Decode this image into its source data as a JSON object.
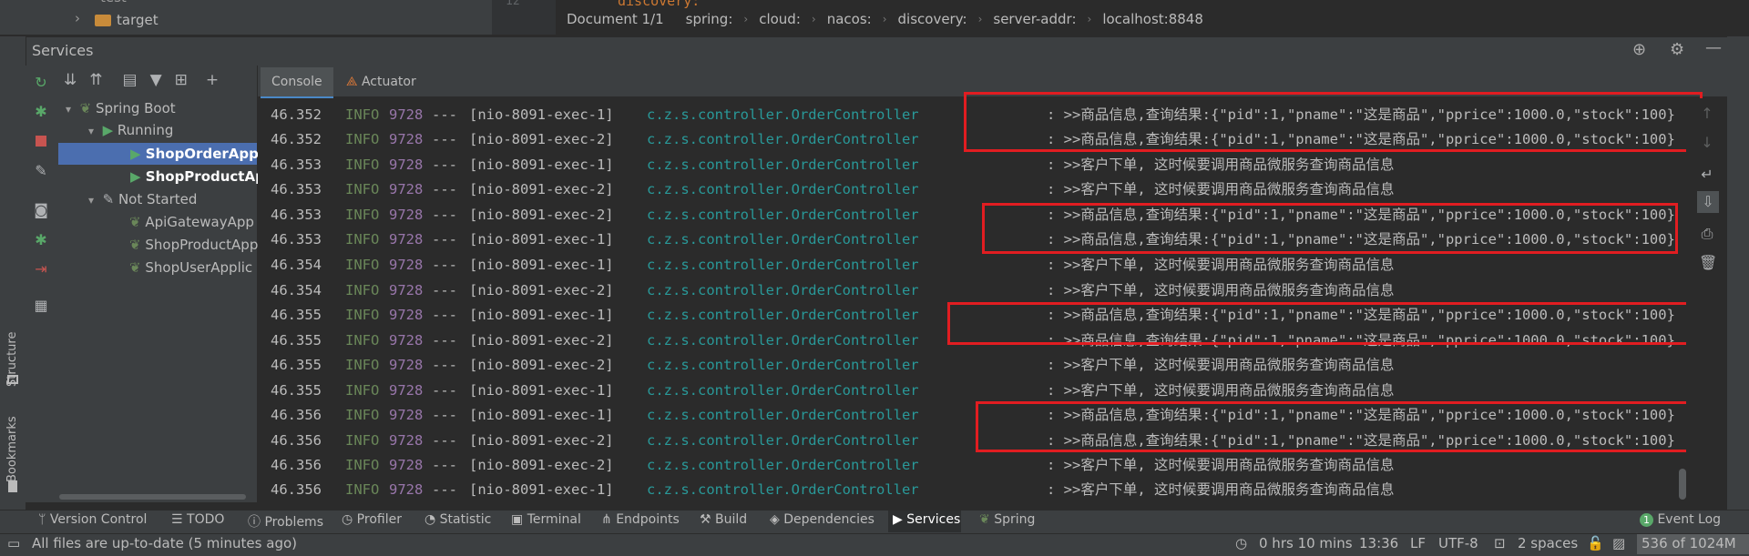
{
  "project": {
    "tree_item_partial": "test",
    "tree_item_target": "target"
  },
  "editor": {
    "code_fragment": "discovery:"
  },
  "breadcrumb": [
    "Document 1/1",
    "spring:",
    "cloud:",
    "nacos:",
    "discovery:",
    "server-addr:",
    "localhost:8848"
  ],
  "services": {
    "title": "Services",
    "tree": {
      "root": "Spring Boot",
      "running_group": "Running",
      "running": [
        "ShopOrderAppl",
        "ShopProductAp"
      ],
      "not_started_group": "Not Started",
      "not_started": [
        "ApiGatewayApp",
        "ShopProductApp",
        "ShopUserApplic"
      ]
    },
    "tabs": [
      "Console",
      "Actuator"
    ]
  },
  "log_lines": [
    {
      "time": "46.352",
      "level": "INFO",
      "pid": "9728",
      "dash": "---",
      "thread": "[nio-8091-exec-1]",
      "logger": "c.z.s.controller.OrderController",
      "message": ": >>商品信息,查询结果:{\"pid\":1,\"pname\":\"这是商品\",\"pprice\":1000.0,\"stock\":100}"
    },
    {
      "time": "46.352",
      "level": "INFO",
      "pid": "9728",
      "dash": "---",
      "thread": "[nio-8091-exec-2]",
      "logger": "c.z.s.controller.OrderController",
      "message": ": >>商品信息,查询结果:{\"pid\":1,\"pname\":\"这是商品\",\"pprice\":1000.0,\"stock\":100}"
    },
    {
      "time": "46.353",
      "level": "INFO",
      "pid": "9728",
      "dash": "---",
      "thread": "[nio-8091-exec-1]",
      "logger": "c.z.s.controller.OrderController",
      "message": ": >>客户下单, 这时候要调用商品微服务查询商品信息"
    },
    {
      "time": "46.353",
      "level": "INFO",
      "pid": "9728",
      "dash": "---",
      "thread": "[nio-8091-exec-2]",
      "logger": "c.z.s.controller.OrderController",
      "message": ": >>客户下单, 这时候要调用商品微服务查询商品信息"
    },
    {
      "time": "46.353",
      "level": "INFO",
      "pid": "9728",
      "dash": "---",
      "thread": "[nio-8091-exec-2]",
      "logger": "c.z.s.controller.OrderController",
      "message": ": >>商品信息,查询结果:{\"pid\":1,\"pname\":\"这是商品\",\"pprice\":1000.0,\"stock\":100}"
    },
    {
      "time": "46.353",
      "level": "INFO",
      "pid": "9728",
      "dash": "---",
      "thread": "[nio-8091-exec-1]",
      "logger": "c.z.s.controller.OrderController",
      "message": ": >>商品信息,查询结果:{\"pid\":1,\"pname\":\"这是商品\",\"pprice\":1000.0,\"stock\":100}"
    },
    {
      "time": "46.354",
      "level": "INFO",
      "pid": "9728",
      "dash": "---",
      "thread": "[nio-8091-exec-1]",
      "logger": "c.z.s.controller.OrderController",
      "message": ": >>客户下单, 这时候要调用商品微服务查询商品信息"
    },
    {
      "time": "46.354",
      "level": "INFO",
      "pid": "9728",
      "dash": "---",
      "thread": "[nio-8091-exec-2]",
      "logger": "c.z.s.controller.OrderController",
      "message": ": >>客户下单, 这时候要调用商品微服务查询商品信息"
    },
    {
      "time": "46.355",
      "level": "INFO",
      "pid": "9728",
      "dash": "---",
      "thread": "[nio-8091-exec-1]",
      "logger": "c.z.s.controller.OrderController",
      "message": ": >>商品信息,查询结果:{\"pid\":1,\"pname\":\"这是商品\",\"pprice\":1000.0,\"stock\":100}"
    },
    {
      "time": "46.355",
      "level": "INFO",
      "pid": "9728",
      "dash": "---",
      "thread": "[nio-8091-exec-2]",
      "logger": "c.z.s.controller.OrderController",
      "message": ": >>商品信息,查询结果:{\"pid\":1,\"pname\":\"这是商品\",\"pprice\":1000.0,\"stock\":100}"
    },
    {
      "time": "46.355",
      "level": "INFO",
      "pid": "9728",
      "dash": "---",
      "thread": "[nio-8091-exec-2]",
      "logger": "c.z.s.controller.OrderController",
      "message": ": >>客户下单, 这时候要调用商品微服务查询商品信息"
    },
    {
      "time": "46.355",
      "level": "INFO",
      "pid": "9728",
      "dash": "---",
      "thread": "[nio-8091-exec-1]",
      "logger": "c.z.s.controller.OrderController",
      "message": ": >>客户下单, 这时候要调用商品微服务查询商品信息"
    },
    {
      "time": "46.356",
      "level": "INFO",
      "pid": "9728",
      "dash": "---",
      "thread": "[nio-8091-exec-1]",
      "logger": "c.z.s.controller.OrderController",
      "message": ": >>商品信息,查询结果:{\"pid\":1,\"pname\":\"这是商品\",\"pprice\":1000.0,\"stock\":100}"
    },
    {
      "time": "46.356",
      "level": "INFO",
      "pid": "9728",
      "dash": "---",
      "thread": "[nio-8091-exec-2]",
      "logger": "c.z.s.controller.OrderController",
      "message": ": >>商品信息,查询结果:{\"pid\":1,\"pname\":\"这是商品\",\"pprice\":1000.0,\"stock\":100}"
    },
    {
      "time": "46.356",
      "level": "INFO",
      "pid": "9728",
      "dash": "---",
      "thread": "[nio-8091-exec-2]",
      "logger": "c.z.s.controller.OrderController",
      "message": ": >>客户下单, 这时候要调用商品微服务查询商品信息"
    },
    {
      "time": "46.356",
      "level": "INFO",
      "pid": "9728",
      "dash": "---",
      "thread": "[nio-8091-exec-1]",
      "logger": "c.z.s.controller.OrderController",
      "message": ": >>客户下单, 这时候要调用商品微服务查询商品信息"
    }
  ],
  "side_labels": {
    "structure": "Structure",
    "bookmarks": "Bookmarks"
  },
  "tool_windows": [
    "Version Control",
    "TODO",
    "Problems",
    "Profiler",
    "Statistic",
    "Terminal",
    "Endpoints",
    "Build",
    "Dependencies",
    "Services",
    "Spring"
  ],
  "event_log": "Event Log",
  "status": {
    "message": "All files are up-to-date (5 minutes ago)",
    "timer": "0 hrs 10 mins",
    "position": "13:36",
    "line_sep": "LF",
    "encoding": "UTF-8",
    "indent": "2 spaces",
    "memory": "536 of 1024M",
    "event_log_badge": "1"
  },
  "colors": {
    "highlight_box": "#e11d21",
    "logger_teal": "#299999",
    "info_green": "#6a8759",
    "pid_purple": "#9876aa",
    "selection": "#4b6eaf"
  }
}
